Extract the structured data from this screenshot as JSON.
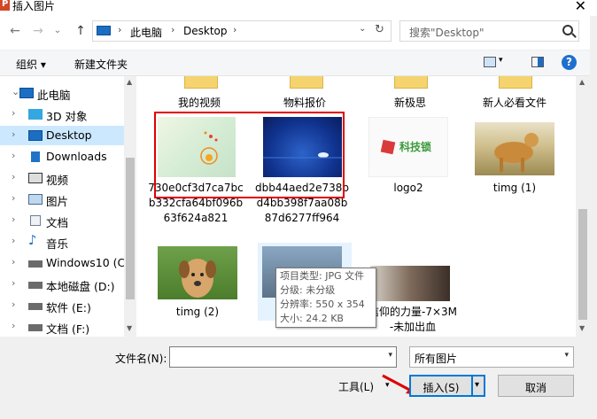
{
  "window": {
    "title": "插入图片",
    "close_glyph": "✕"
  },
  "nav_buttons": {
    "back": "←",
    "forward": "→",
    "recent": "⌄",
    "up": "↑"
  },
  "address": {
    "segments": [
      "此电脑",
      "Desktop"
    ],
    "separator": "›",
    "dropdown": "⌄",
    "refresh": "↻"
  },
  "search": {
    "placeholder": "搜索\"Desktop\""
  },
  "toolbar": {
    "organize": "组织 ▾",
    "new_folder": "新建文件夹",
    "view_dropdown": "▾",
    "help": "?"
  },
  "sidebar": {
    "items": [
      {
        "label": "此电脑",
        "icon": "computer-icon",
        "chevron": "⌄",
        "selected": false
      },
      {
        "label": "3D 对象",
        "icon": "3d-objects-icon",
        "chevron": "›",
        "selected": false
      },
      {
        "label": "Desktop",
        "icon": "desktop-icon",
        "chevron": "›",
        "selected": true
      },
      {
        "label": "Downloads",
        "icon": "downloads-icon",
        "chevron": "›",
        "selected": false
      },
      {
        "label": "视频",
        "icon": "video-icon",
        "chevron": "›",
        "selected": false
      },
      {
        "label": "图片",
        "icon": "pictures-icon",
        "chevron": "›",
        "selected": false
      },
      {
        "label": "文档",
        "icon": "documents-icon",
        "chevron": "›",
        "selected": false
      },
      {
        "label": "音乐",
        "icon": "music-icon",
        "chevron": "›",
        "selected": false
      },
      {
        "label": "Windows10 (C:",
        "icon": "drive-c-icon",
        "chevron": "›",
        "selected": false
      },
      {
        "label": "本地磁盘 (D:)",
        "icon": "drive-icon",
        "chevron": "›",
        "selected": false
      },
      {
        "label": "软件 (E:)",
        "icon": "drive-icon",
        "chevron": "›",
        "selected": false
      },
      {
        "label": "文档 (F:)",
        "icon": "drive-icon",
        "chevron": "›",
        "selected": false
      }
    ]
  },
  "folders": [
    {
      "label": "我的视频"
    },
    {
      "label": "物料报价"
    },
    {
      "label": "新极思"
    },
    {
      "label": "新人必看文件"
    }
  ],
  "files": [
    {
      "label": "730e0cf3d7ca7bcb332cfa64bf096b63f624a821"
    },
    {
      "label": "dbb44aed2e738bd4bb398f7aa08b87d6277ff964"
    },
    {
      "label": "logo2"
    },
    {
      "label": "timg (1)"
    },
    {
      "label": "timg (2)"
    },
    {
      "label": "timg"
    },
    {
      "label": "信仰的力量-7×3M-未加出血"
    }
  ],
  "logo_text": "科技锁",
  "tooltip": {
    "line1": "项目类型: JPG 文件",
    "line2": "分级: 未分级",
    "line3": "分辨率: 550 x 354",
    "line4": "大小: 24.2 KB"
  },
  "bottom": {
    "filename_label": "文件名(N):",
    "filename_value": "",
    "filter_value": "所有图片",
    "tools_label": "工具(L)",
    "insert_label": "插入(S)",
    "cancel_label": "取消",
    "dropdown_glyph": "▾"
  },
  "colors": {
    "accent": "#0078d7",
    "selection": "#cce8ff",
    "highlight_box": "#e00000"
  }
}
